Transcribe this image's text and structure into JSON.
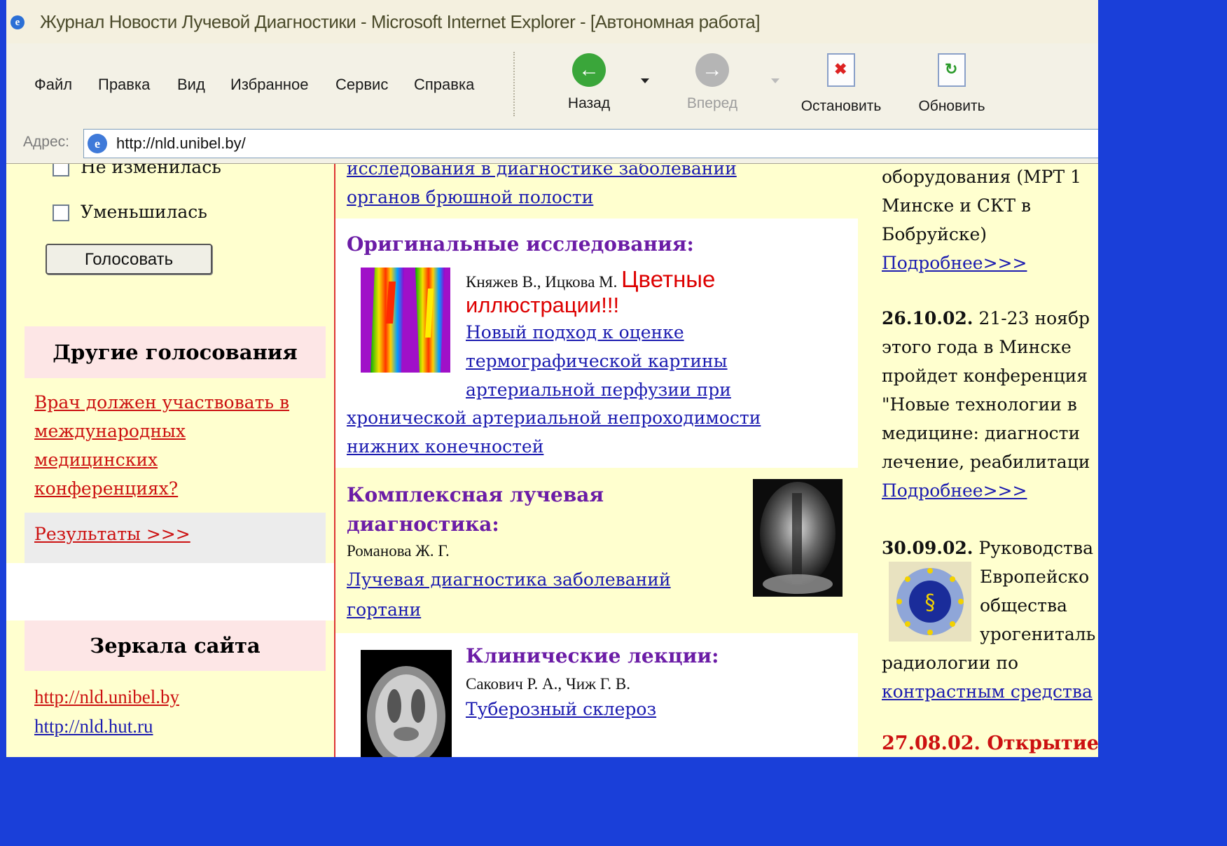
{
  "window": {
    "title": "Журнал Новости Лучевой Диагностики - Microsoft Internet Explorer - [Автономная работа]"
  },
  "menu": [
    "Файл",
    "Правка",
    "Вид",
    "Избранное",
    "Сервис",
    "Справка"
  ],
  "toolbar": {
    "back": "Назад",
    "forward": "Вперед",
    "stop": "Остановить",
    "refresh": "Обновить"
  },
  "address": {
    "label": "Адрес:",
    "url": "http://nld.unibel.by/"
  },
  "left": {
    "poll_option_partial": "Не изменилась",
    "poll_option": "Уменьшилась",
    "vote_button": "Голосовать",
    "other_polls_title": "Другие голосования",
    "other_poll_link": [
      "Врач должен участвовать в",
      "международных",
      "медицинских",
      "конференциях?"
    ],
    "results_link": "Результаты >>>",
    "mirrors_title": "Зеркала сайта",
    "mirrors": [
      "http://nld.unibel.by",
      "http://nld.hut.ru"
    ]
  },
  "middle": {
    "top_link_lines": [
      "исследования в диагностике заболеваний",
      "органов брюшной полости"
    ],
    "original": {
      "title": "Оригинальные исследования:",
      "authors": "Княжев В., Ицкова М.",
      "highlight_line1": "Цветные",
      "highlight_line2": "иллюстрации!!!",
      "link_lines": [
        "Новый подход к оценке",
        "термографической картины",
        "артериальной перфузии при",
        "хронической артериальной непроходимости",
        "нижних конечностей"
      ]
    },
    "complex": {
      "title_line1": "Комплексная лучевая",
      "title_line2": "диагностика:",
      "authors": "Романова Ж. Г.",
      "link_lines": [
        "Лучевая диагностика заболеваний",
        "гортани"
      ]
    },
    "lectures": {
      "title": "Клинические лекции:",
      "authors": "Сакович Р. А., Чиж Г. В.",
      "link": "Туберозный склероз"
    }
  },
  "right": {
    "partial_lines": [
      "оборудования (МРТ 1",
      "Минске и СКТ в",
      "Бобруйске)"
    ],
    "more1": "Подробнее>>>",
    "news2_date": "26.10.02.",
    "news2_lines": [
      "21-23 ноябр",
      "этого года в Минске",
      "пройдет конференция",
      "\"Новые технологии в",
      "медицине: диагности",
      "лечение, реабилитаци"
    ],
    "more2": "Подробнее>>>",
    "news3_date": "30.09.02.",
    "news3_lines": [
      "Руководства",
      "Европейско",
      "общества",
      "урогениталь",
      "радиологии по"
    ],
    "news3_link": "контрастным средства",
    "news4": "27.08.02. Открытие"
  },
  "colors": {
    "slide_bg": "#1a3fd9",
    "pale_yellow": "#ffffcf",
    "section_purple": "#6b1ca6",
    "link_blue": "#1b1bb0",
    "red": "#cc1111"
  }
}
